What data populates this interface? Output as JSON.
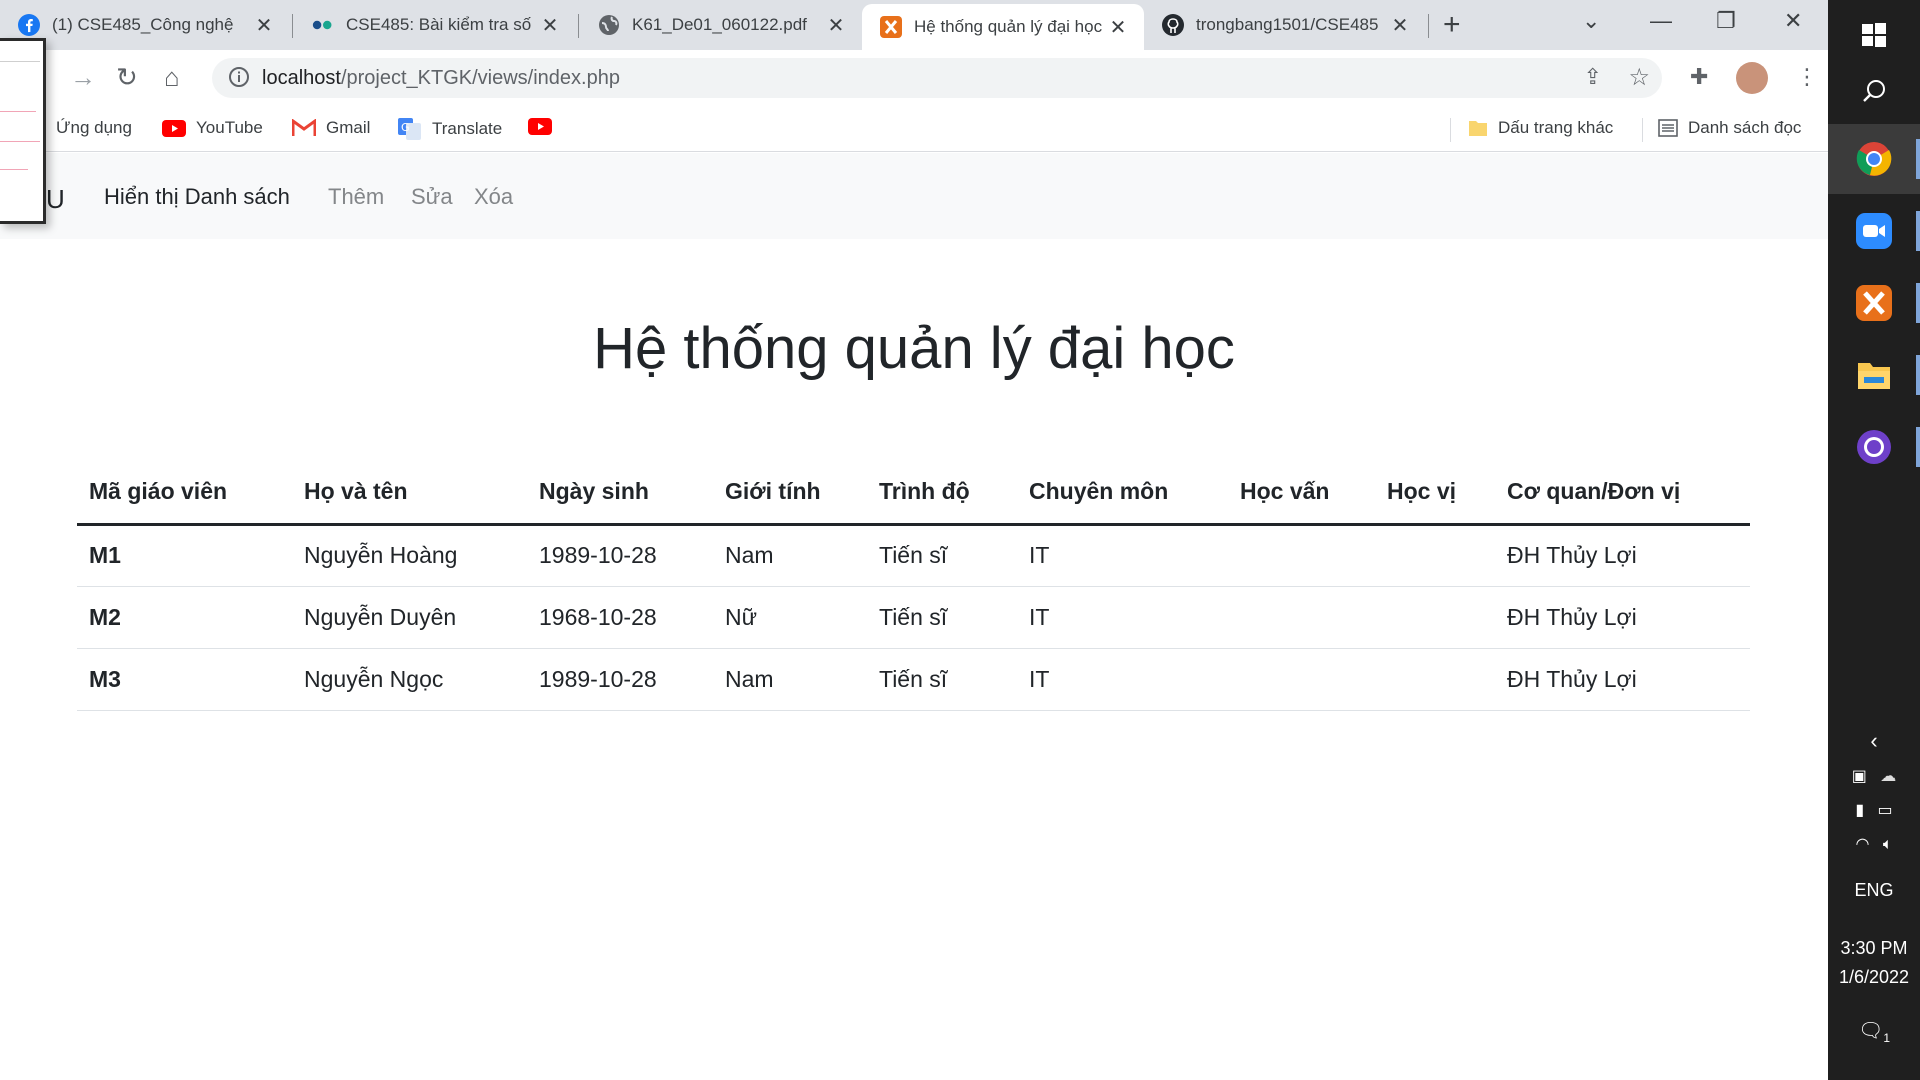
{
  "browser": {
    "tabs": [
      {
        "title": "(1) CSE485_Công nghệ",
        "icon": "facebook-icon"
      },
      {
        "title": "CSE485: Bài kiểm tra số",
        "icon": "classroom-icon"
      },
      {
        "title": "K61_De01_060122.pdf",
        "icon": "globe-icon"
      },
      {
        "title": "Hệ thống quản lý đại học",
        "icon": "xampp-icon"
      },
      {
        "title": "trongbang1501/CSE485",
        "icon": "github-icon"
      }
    ],
    "url_host": "localhost",
    "url_path": "/project_KTGK/views/index.php",
    "bookmarks": [
      {
        "label": "Ứng dụng",
        "icon": "apps-icon"
      },
      {
        "label": "YouTube",
        "icon": "youtube-icon"
      },
      {
        "label": "Gmail",
        "icon": "gmail-icon"
      },
      {
        "label": "Translate",
        "icon": "translate-icon"
      },
      {
        "label": "",
        "icon": "youtube-icon"
      }
    ],
    "other_bookmarks": "Dấu trang khác",
    "reading_list": "Danh sách đọc"
  },
  "page": {
    "brand_fragment": "U",
    "nav": [
      {
        "label": "Hiển thị Danh sách",
        "active": true
      },
      {
        "label": "Thêm",
        "active": false
      },
      {
        "label": "Sửa",
        "active": false
      },
      {
        "label": "Xóa",
        "active": false
      }
    ],
    "heading": "Hệ thống quản lý đại học",
    "table": {
      "headers": [
        "Mã giáo viên",
        "Họ và tên",
        "Ngày sinh",
        "Giới tính",
        "Trình độ",
        "Chuyên môn",
        "Học vấn",
        "Học vị",
        "Cơ quan/Đơn vị"
      ],
      "rows": [
        [
          "M1",
          "Nguyễn Hoàng",
          "1989-10-28",
          "Nam",
          "Tiến sĩ",
          "IT",
          "",
          "",
          "ĐH Thủy Lợi"
        ],
        [
          "M2",
          "Nguyễn Duyên",
          "1968-10-28",
          "Nữ",
          "Tiến sĩ",
          "IT",
          "",
          "",
          "ĐH Thủy Lợi"
        ],
        [
          "M3",
          "Nguyễn Ngọc",
          "1989-10-28",
          "Nam",
          "Tiến sĩ",
          "IT",
          "",
          "",
          "ĐH Thủy Lợi"
        ]
      ]
    }
  },
  "taskbar": {
    "language": "ENG",
    "time": "3:30 PM",
    "date": "1/6/2022",
    "notification_count": "1"
  },
  "colors": {
    "accent": "#212529",
    "nav_bg": "#f8f9fa",
    "taskbar_bg": "#1f1f1f"
  }
}
